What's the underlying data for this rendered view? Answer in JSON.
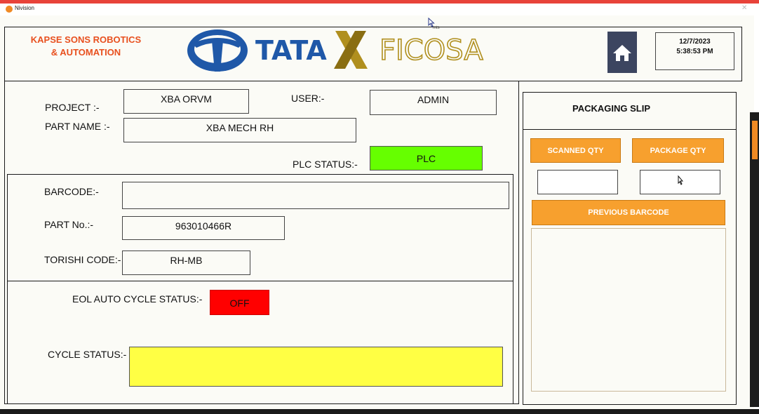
{
  "window": {
    "title": "Nivision"
  },
  "header": {
    "company_line1": "KAPSE SONS ROBOTICS",
    "company_line2": "& AUTOMATION",
    "logo_text_tata": "TATA",
    "logo_text_ficosa": "FICOSA",
    "date": "12/7/2023",
    "time": "5:38:53 PM"
  },
  "form": {
    "project_label": "PROJECT :-",
    "project_value": "XBA ORVM",
    "user_label": "USER:-",
    "user_value": "ADMIN",
    "part_name_label": "PART NAME :-",
    "part_name_value": "XBA MECH RH",
    "plc_status_label": "PLC STATUS:-",
    "plc_value": "PLC",
    "barcode_label": "BARCODE:-",
    "barcode_value": "",
    "part_no_label": "PART No.:-",
    "part_no_value": "963010466R",
    "torishi_label": "TORISHI CODE:-",
    "torishi_value": "RH-MB",
    "eol_label": "EOL AUTO CYCLE STATUS:-",
    "eol_value": "OFF",
    "cycle_label": "CYCLE STATUS:-",
    "cycle_value": ""
  },
  "packaging": {
    "title": "PACKAGING SLIP",
    "scanned_qty_label": "SCANNED QTY",
    "package_qty_label": "PACKAGE QTY",
    "scanned_qty_value": "",
    "package_qty_value": "",
    "previous_barcode_label": "PREVIOUS BARCODE"
  },
  "cursor_tag": "mts",
  "colors": {
    "plc": "#66ff00",
    "off": "#ff0000",
    "cycle": "#ffff44",
    "orange": "#f7a02e",
    "home": "#3c4560",
    "company": "#e8501f",
    "tata_blue": "#1f58a8",
    "ficosa_gold": "#b08f1e"
  },
  "icons": {
    "home": "home-icon",
    "tata_logo": "tata-logo",
    "cursor": "mouse-cursor-icon"
  }
}
